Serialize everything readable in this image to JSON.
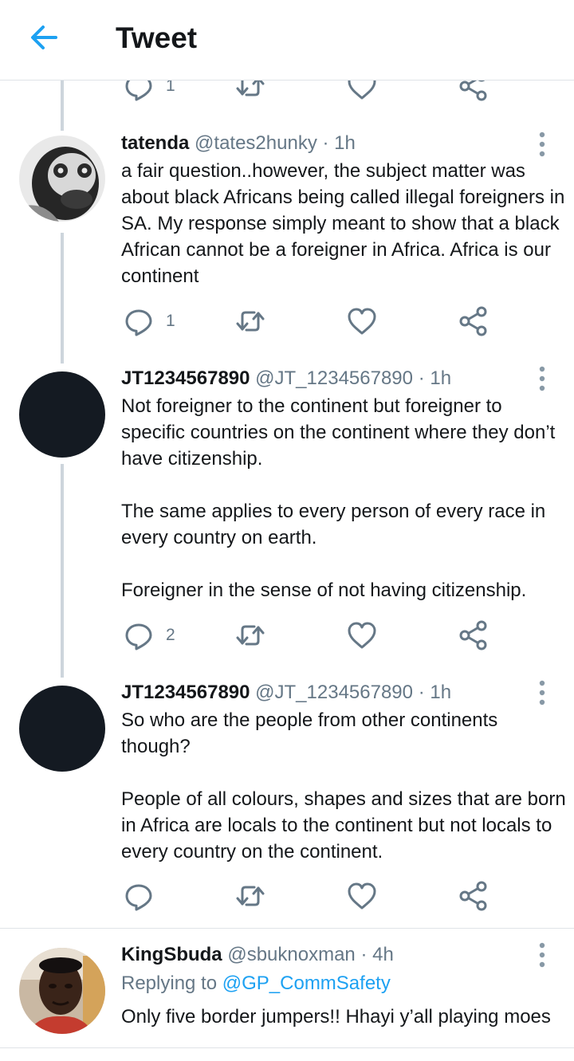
{
  "header": {
    "title": "Tweet"
  },
  "top_actions": {
    "reply_count": "1"
  },
  "tweets": [
    {
      "name": "tatenda",
      "handle": "@tates2hunky",
      "time": "· 1h",
      "text": [
        "a fair question..however, the subject matter was about black Africans being called illegal foreigners in SA. My response simply meant to show that a black African cannot be a foreigner in Africa. Africa is our continent"
      ],
      "reply_count": "1"
    },
    {
      "name": "JT1234567890",
      "handle": "@JT_1234567890",
      "time": "· 1h",
      "text": [
        "Not foreigner to the continent but foreigner to specific countries on the continent where they don’t have citizenship.",
        "The same applies to every person of every race in every country on earth.",
        "Foreigner in the sense of not having citizenship."
      ],
      "reply_count": "2"
    },
    {
      "name": "JT1234567890",
      "handle": "@JT_1234567890",
      "time": "· 1h",
      "text": [
        "So who are the people from other continents though?",
        "People of all colours, shapes and sizes that are born in Africa are locals to the continent but not locals to every country on the continent."
      ],
      "reply_count": ""
    },
    {
      "name": "KingSbuda",
      "handle": "@sbuknoxman",
      "time": "· 4h",
      "replying_prefix": "Replying to",
      "replying_to": "@GP_CommSafety",
      "text": [
        "Only five border jumpers!! Hhayi y’all playing moes"
      ],
      "reply_count": ""
    }
  ],
  "colors": {
    "accent": "#1da1f2",
    "icon": "#657786",
    "text": "#14171a",
    "thread_line": "#cdd5dc",
    "divider": "#dfe3e7"
  },
  "icons": {
    "back": "arrow-left-icon",
    "reply": "comment-bubble-icon",
    "retweet": "retweet-icon",
    "like": "heart-icon",
    "share": "share-icon",
    "more": "vertical-dots-icon"
  }
}
